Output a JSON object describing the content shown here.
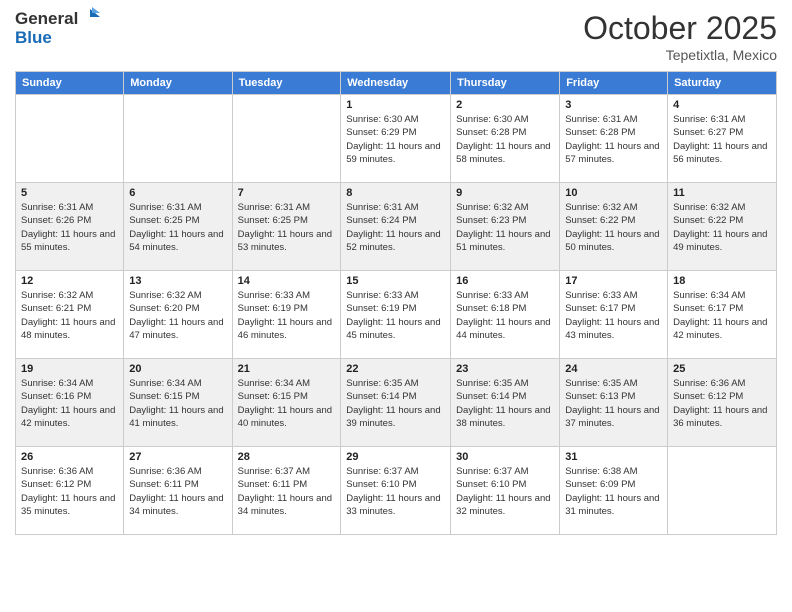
{
  "header": {
    "logo_general": "General",
    "logo_blue": "Blue",
    "month_title": "October 2025",
    "location": "Tepetixtla, Mexico"
  },
  "weekdays": [
    "Sunday",
    "Monday",
    "Tuesday",
    "Wednesday",
    "Thursday",
    "Friday",
    "Saturday"
  ],
  "weeks": [
    [
      {
        "day": "",
        "sunrise": "",
        "sunset": "",
        "daylight": ""
      },
      {
        "day": "",
        "sunrise": "",
        "sunset": "",
        "daylight": ""
      },
      {
        "day": "",
        "sunrise": "",
        "sunset": "",
        "daylight": ""
      },
      {
        "day": "1",
        "sunrise": "Sunrise: 6:30 AM",
        "sunset": "Sunset: 6:29 PM",
        "daylight": "Daylight: 11 hours and 59 minutes."
      },
      {
        "day": "2",
        "sunrise": "Sunrise: 6:30 AM",
        "sunset": "Sunset: 6:28 PM",
        "daylight": "Daylight: 11 hours and 58 minutes."
      },
      {
        "day": "3",
        "sunrise": "Sunrise: 6:31 AM",
        "sunset": "Sunset: 6:28 PM",
        "daylight": "Daylight: 11 hours and 57 minutes."
      },
      {
        "day": "4",
        "sunrise": "Sunrise: 6:31 AM",
        "sunset": "Sunset: 6:27 PM",
        "daylight": "Daylight: 11 hours and 56 minutes."
      }
    ],
    [
      {
        "day": "5",
        "sunrise": "Sunrise: 6:31 AM",
        "sunset": "Sunset: 6:26 PM",
        "daylight": "Daylight: 11 hours and 55 minutes."
      },
      {
        "day": "6",
        "sunrise": "Sunrise: 6:31 AM",
        "sunset": "Sunset: 6:25 PM",
        "daylight": "Daylight: 11 hours and 54 minutes."
      },
      {
        "day": "7",
        "sunrise": "Sunrise: 6:31 AM",
        "sunset": "Sunset: 6:25 PM",
        "daylight": "Daylight: 11 hours and 53 minutes."
      },
      {
        "day": "8",
        "sunrise": "Sunrise: 6:31 AM",
        "sunset": "Sunset: 6:24 PM",
        "daylight": "Daylight: 11 hours and 52 minutes."
      },
      {
        "day": "9",
        "sunrise": "Sunrise: 6:32 AM",
        "sunset": "Sunset: 6:23 PM",
        "daylight": "Daylight: 11 hours and 51 minutes."
      },
      {
        "day": "10",
        "sunrise": "Sunrise: 6:32 AM",
        "sunset": "Sunset: 6:22 PM",
        "daylight": "Daylight: 11 hours and 50 minutes."
      },
      {
        "day": "11",
        "sunrise": "Sunrise: 6:32 AM",
        "sunset": "Sunset: 6:22 PM",
        "daylight": "Daylight: 11 hours and 49 minutes."
      }
    ],
    [
      {
        "day": "12",
        "sunrise": "Sunrise: 6:32 AM",
        "sunset": "Sunset: 6:21 PM",
        "daylight": "Daylight: 11 hours and 48 minutes."
      },
      {
        "day": "13",
        "sunrise": "Sunrise: 6:32 AM",
        "sunset": "Sunset: 6:20 PM",
        "daylight": "Daylight: 11 hours and 47 minutes."
      },
      {
        "day": "14",
        "sunrise": "Sunrise: 6:33 AM",
        "sunset": "Sunset: 6:19 PM",
        "daylight": "Daylight: 11 hours and 46 minutes."
      },
      {
        "day": "15",
        "sunrise": "Sunrise: 6:33 AM",
        "sunset": "Sunset: 6:19 PM",
        "daylight": "Daylight: 11 hours and 45 minutes."
      },
      {
        "day": "16",
        "sunrise": "Sunrise: 6:33 AM",
        "sunset": "Sunset: 6:18 PM",
        "daylight": "Daylight: 11 hours and 44 minutes."
      },
      {
        "day": "17",
        "sunrise": "Sunrise: 6:33 AM",
        "sunset": "Sunset: 6:17 PM",
        "daylight": "Daylight: 11 hours and 43 minutes."
      },
      {
        "day": "18",
        "sunrise": "Sunrise: 6:34 AM",
        "sunset": "Sunset: 6:17 PM",
        "daylight": "Daylight: 11 hours and 42 minutes."
      }
    ],
    [
      {
        "day": "19",
        "sunrise": "Sunrise: 6:34 AM",
        "sunset": "Sunset: 6:16 PM",
        "daylight": "Daylight: 11 hours and 42 minutes."
      },
      {
        "day": "20",
        "sunrise": "Sunrise: 6:34 AM",
        "sunset": "Sunset: 6:15 PM",
        "daylight": "Daylight: 11 hours and 41 minutes."
      },
      {
        "day": "21",
        "sunrise": "Sunrise: 6:34 AM",
        "sunset": "Sunset: 6:15 PM",
        "daylight": "Daylight: 11 hours and 40 minutes."
      },
      {
        "day": "22",
        "sunrise": "Sunrise: 6:35 AM",
        "sunset": "Sunset: 6:14 PM",
        "daylight": "Daylight: 11 hours and 39 minutes."
      },
      {
        "day": "23",
        "sunrise": "Sunrise: 6:35 AM",
        "sunset": "Sunset: 6:14 PM",
        "daylight": "Daylight: 11 hours and 38 minutes."
      },
      {
        "day": "24",
        "sunrise": "Sunrise: 6:35 AM",
        "sunset": "Sunset: 6:13 PM",
        "daylight": "Daylight: 11 hours and 37 minutes."
      },
      {
        "day": "25",
        "sunrise": "Sunrise: 6:36 AM",
        "sunset": "Sunset: 6:12 PM",
        "daylight": "Daylight: 11 hours and 36 minutes."
      }
    ],
    [
      {
        "day": "26",
        "sunrise": "Sunrise: 6:36 AM",
        "sunset": "Sunset: 6:12 PM",
        "daylight": "Daylight: 11 hours and 35 minutes."
      },
      {
        "day": "27",
        "sunrise": "Sunrise: 6:36 AM",
        "sunset": "Sunset: 6:11 PM",
        "daylight": "Daylight: 11 hours and 34 minutes."
      },
      {
        "day": "28",
        "sunrise": "Sunrise: 6:37 AM",
        "sunset": "Sunset: 6:11 PM",
        "daylight": "Daylight: 11 hours and 34 minutes."
      },
      {
        "day": "29",
        "sunrise": "Sunrise: 6:37 AM",
        "sunset": "Sunset: 6:10 PM",
        "daylight": "Daylight: 11 hours and 33 minutes."
      },
      {
        "day": "30",
        "sunrise": "Sunrise: 6:37 AM",
        "sunset": "Sunset: 6:10 PM",
        "daylight": "Daylight: 11 hours and 32 minutes."
      },
      {
        "day": "31",
        "sunrise": "Sunrise: 6:38 AM",
        "sunset": "Sunset: 6:09 PM",
        "daylight": "Daylight: 11 hours and 31 minutes."
      },
      {
        "day": "",
        "sunrise": "",
        "sunset": "",
        "daylight": ""
      }
    ]
  ]
}
